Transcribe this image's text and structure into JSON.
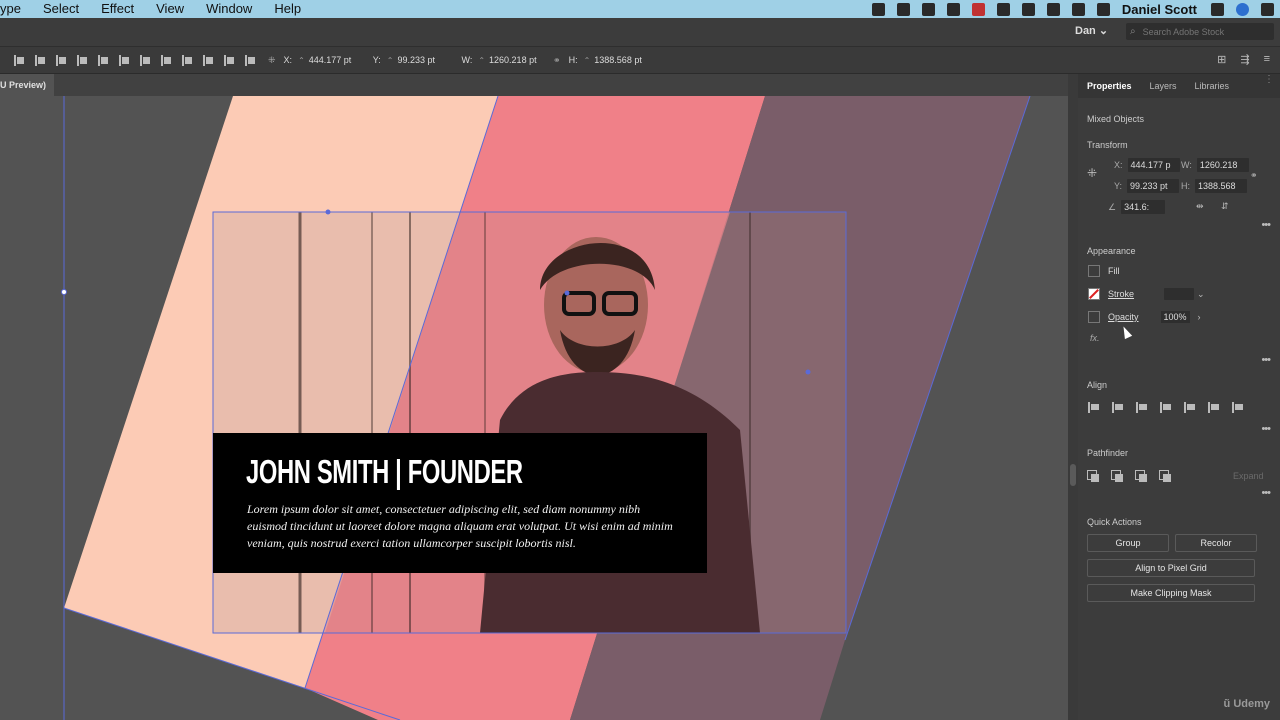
{
  "menubar": {
    "items": [
      "ype",
      "Select",
      "Effect",
      "View",
      "Window",
      "Help"
    ],
    "user": "Daniel Scott"
  },
  "appbar": {
    "user_menu": "Dan",
    "stock_search_placeholder": "Search Adobe Stock"
  },
  "controlbar": {
    "x_label": "X:",
    "x_value": "444.177 pt",
    "y_label": "Y:",
    "y_value": "99.233 pt",
    "w_label": "W:",
    "w_value": "1260.218 pt",
    "h_label": "H:",
    "h_value": "1388.568 pt"
  },
  "doc_tab": "U Preview)",
  "artwork": {
    "title": "JOHN SMITH | FOUNDER",
    "body": "Lorem ipsum dolor sit amet, consectetuer adipiscing elit, sed diam nonummy nibh euismod tincidunt ut laoreet dolore magna aliquam erat volutpat. Ut wisi enim ad minim veniam, quis nostrud exerci tation ullamcorper suscipit lobortis nisl.",
    "colors": {
      "peach": "#fccbb5",
      "pink": "#f08088",
      "mauve": "#7a5d69",
      "selection": "#5a6ad8"
    }
  },
  "panel": {
    "tabs": [
      "Properties",
      "Layers",
      "Libraries"
    ],
    "selection": "Mixed Objects",
    "transform": {
      "title": "Transform",
      "x_label": "X:",
      "x_value": "444.177 p",
      "y_label": "Y:",
      "y_value": "99.233 pt",
      "w_label": "W:",
      "w_value": "1260.218",
      "h_label": "H:",
      "h_value": "1388.568",
      "angle_value": "341.6:"
    },
    "appearance": {
      "title": "Appearance",
      "fill_label": "Fill",
      "stroke_label": "Stroke",
      "opacity_label": "Opacity",
      "opacity_value": "100%",
      "fx_label": "fx."
    },
    "align_title": "Align",
    "pathfinder": {
      "title": "Pathfinder",
      "expand_label": "Expand"
    },
    "quick_actions": {
      "title": "Quick Actions",
      "group": "Group",
      "recolor": "Recolor",
      "align_pixel": "Align to Pixel Grid",
      "clipping_mask": "Make Clipping Mask"
    },
    "watermark": "Udemy"
  }
}
